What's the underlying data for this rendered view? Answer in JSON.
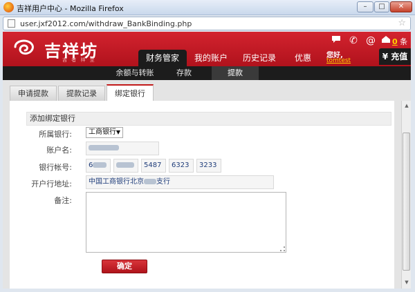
{
  "window": {
    "title": "吉祥用户中心 - Mozilla Firefox",
    "minimize": "–",
    "maximize": "□",
    "close": "✕"
  },
  "browser": {
    "url": "user.jxf2012.com/withdraw_BankBinding.php",
    "bookmark_icon": "star-icon"
  },
  "site": {
    "logo_text": "吉祥坊",
    "logo_sub": "吉 者 祥 至",
    "nav": [
      "财务管家",
      "我的账户",
      "历史记录",
      "优惠"
    ],
    "active_nav_index": 0,
    "tools": [
      "chat-icon",
      "phone-icon",
      "email-at-icon",
      "inbox-icon"
    ],
    "message_count": "0",
    "message_unit": "条",
    "greeting": "您好,",
    "username": "tomtest",
    "recharge_label": "¥ 充值",
    "subnav": [
      "余额与转账",
      "存款",
      "提款"
    ],
    "active_subnav_index": 2,
    "brand_color": "#c8161d"
  },
  "page": {
    "tabs": [
      "申请提款",
      "提款记录",
      "绑定银行"
    ],
    "active_tab_index": 2,
    "section_title": "添加绑定银行",
    "form": {
      "bank_label": "所属银行:",
      "bank_value": "工商银行",
      "account_name_label": "账户名:",
      "account_number_label": "银行帐号:",
      "account_number_parts": [
        "6",
        "",
        "5487",
        "6323",
        "3233"
      ],
      "branch_label": "开户行地址:",
      "branch_prefix": "中国工商银行北京",
      "branch_suffix": "支行",
      "notes_label": "备注:",
      "confirm_label": "确定"
    }
  }
}
